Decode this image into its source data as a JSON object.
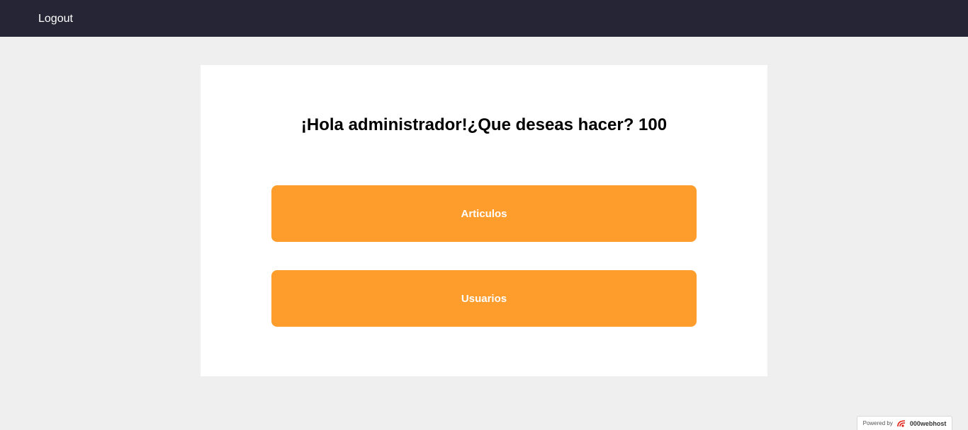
{
  "navbar": {
    "logout_label": "Logout"
  },
  "main": {
    "greeting": "¡Hola administrador!¿Que deseas hacer? 100",
    "buttons": [
      {
        "label": "Articulos"
      },
      {
        "label": "Usuarios"
      }
    ]
  },
  "footer_badge": {
    "powered_by": "Powered by",
    "brand": "000webhost",
    "logo_icon": "000webhost-logo-icon"
  },
  "colors": {
    "navbar_bg": "#262535",
    "page_bg": "#efefef",
    "button_accent": "#fe9c2c"
  }
}
